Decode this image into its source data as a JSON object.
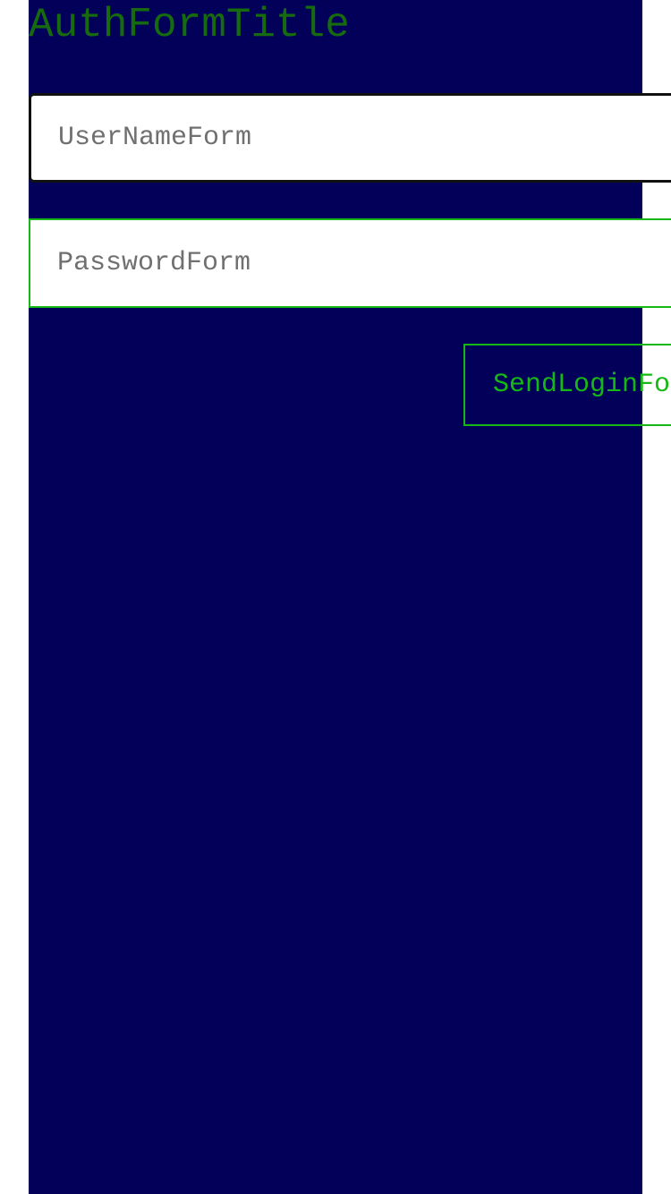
{
  "auth_form": {
    "title": "AuthFormTitle",
    "username_field": {
      "value": "",
      "placeholder": "UserNameForm"
    },
    "password_field": {
      "value": "",
      "placeholder": "PasswordForm"
    },
    "send_button_label": "SendLoginFo"
  },
  "colors": {
    "panel_background": "#03005a",
    "title_text": "#176b0f",
    "accent_green": "#16b816",
    "page_background": "#ffffff"
  }
}
